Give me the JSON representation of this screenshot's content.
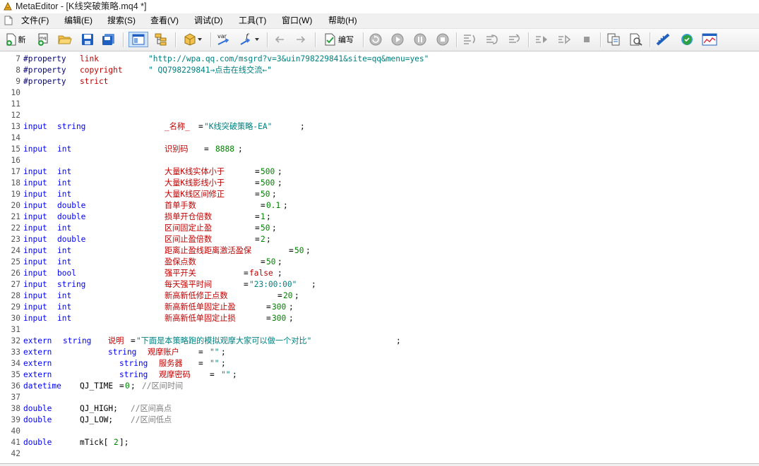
{
  "window": {
    "title": "MetaEditor - [K线突破策略.mq4 *]"
  },
  "menu": [
    {
      "label": "文件(F)"
    },
    {
      "label": "编辑(E)"
    },
    {
      "label": "搜索(S)"
    },
    {
      "label": "查看(V)"
    },
    {
      "label": "调试(D)"
    },
    {
      "label": "工具(T)"
    },
    {
      "label": "窗口(W)"
    },
    {
      "label": "帮助(H)"
    }
  ],
  "toolbar": {
    "new_label": "新",
    "compile_label": "编写",
    "var_label": "var",
    "func_label": "f"
  },
  "code_lines": [
    {
      "n": "7",
      "segs": [
        {
          "t": "#property",
          "c": "dir"
        },
        {
          "t": "link",
          "c": "id"
        },
        {
          "t": "\"http://wpa.qq.com/msgrd?v=3&uin798229841&site=qq&menu=yes\"",
          "c": "str"
        }
      ]
    },
    {
      "n": "8",
      "segs": [
        {
          "t": "#property",
          "c": "dir"
        },
        {
          "t": "copyright",
          "c": "id"
        },
        {
          "t": "\" QQ798229841→点击在线交流←\"",
          "c": "str"
        }
      ]
    },
    {
      "n": "9",
      "segs": [
        {
          "t": "#property",
          "c": "dir"
        },
        {
          "t": "strict",
          "c": "id"
        }
      ]
    },
    {
      "n": "10",
      "segs": []
    },
    {
      "n": "11",
      "segs": []
    },
    {
      "n": "12",
      "segs": []
    },
    {
      "n": "13",
      "segs": [
        {
          "t": "input",
          "c": "kw"
        },
        {
          "t": "string",
          "c": "kw"
        },
        {
          "t": "_名称_",
          "c": "id"
        },
        {
          "t": "=",
          "c": "op"
        },
        {
          "t": "\"K线突破策略-EA\"",
          "c": "str"
        },
        {
          "t": ";",
          "c": "op"
        }
      ]
    },
    {
      "n": "14",
      "segs": []
    },
    {
      "n": "15",
      "segs": [
        {
          "t": "input",
          "c": "kw"
        },
        {
          "t": "int",
          "c": "kw"
        },
        {
          "t": "识别码",
          "c": "id"
        },
        {
          "t": "=",
          "c": "op"
        },
        {
          "t": "8888",
          "c": "num"
        },
        {
          "t": ";",
          "c": "op"
        }
      ]
    },
    {
      "n": "16",
      "segs": []
    },
    {
      "n": "17",
      "segs": [
        {
          "t": "input",
          "c": "kw"
        },
        {
          "t": "int",
          "c": "kw"
        },
        {
          "t": "大量K线实体小于",
          "c": "id"
        },
        {
          "t": "=",
          "c": "op"
        },
        {
          "t": "500",
          "c": "num"
        },
        {
          "t": ";",
          "c": "op"
        }
      ]
    },
    {
      "n": "18",
      "segs": [
        {
          "t": "input",
          "c": "kw"
        },
        {
          "t": "int",
          "c": "kw"
        },
        {
          "t": "大量K线影线小于",
          "c": "id"
        },
        {
          "t": "=",
          "c": "op"
        },
        {
          "t": "500",
          "c": "num"
        },
        {
          "t": ";",
          "c": "op"
        }
      ]
    },
    {
      "n": "19",
      "segs": [
        {
          "t": "input",
          "c": "kw"
        },
        {
          "t": "int",
          "c": "kw"
        },
        {
          "t": "大量K线区间修正",
          "c": "id"
        },
        {
          "t": "=",
          "c": "op"
        },
        {
          "t": "50",
          "c": "num"
        },
        {
          "t": ";",
          "c": "op"
        }
      ]
    },
    {
      "n": "20",
      "segs": [
        {
          "t": "input",
          "c": "kw"
        },
        {
          "t": "double",
          "c": "kw"
        },
        {
          "t": "首单手数",
          "c": "id"
        },
        {
          "t": "=",
          "c": "op"
        },
        {
          "t": "0.1",
          "c": "num"
        },
        {
          "t": ";",
          "c": "op"
        }
      ]
    },
    {
      "n": "21",
      "segs": [
        {
          "t": "input",
          "c": "kw"
        },
        {
          "t": "double",
          "c": "kw"
        },
        {
          "t": "损单开仓倍数",
          "c": "id"
        },
        {
          "t": "=",
          "c": "op"
        },
        {
          "t": "1",
          "c": "num"
        },
        {
          "t": ";",
          "c": "op"
        }
      ]
    },
    {
      "n": "22",
      "segs": [
        {
          "t": "input",
          "c": "kw"
        },
        {
          "t": "int",
          "c": "kw"
        },
        {
          "t": "区间固定止盈",
          "c": "id"
        },
        {
          "t": "=",
          "c": "op"
        },
        {
          "t": "50",
          "c": "num"
        },
        {
          "t": ";",
          "c": "op"
        }
      ]
    },
    {
      "n": "23",
      "segs": [
        {
          "t": "input",
          "c": "kw"
        },
        {
          "t": "double",
          "c": "kw"
        },
        {
          "t": "区间止盈倍数",
          "c": "id"
        },
        {
          "t": "=",
          "c": "op"
        },
        {
          "t": "2",
          "c": "num"
        },
        {
          "t": ";",
          "c": "op"
        }
      ]
    },
    {
      "n": "24",
      "segs": [
        {
          "t": "input",
          "c": "kw"
        },
        {
          "t": "int",
          "c": "kw"
        },
        {
          "t": "距离止盈线距离激活盈保",
          "c": "id"
        },
        {
          "t": "=",
          "c": "op"
        },
        {
          "t": "50",
          "c": "num"
        },
        {
          "t": ";",
          "c": "op"
        }
      ]
    },
    {
      "n": "25",
      "segs": [
        {
          "t": "input",
          "c": "kw"
        },
        {
          "t": "int",
          "c": "kw"
        },
        {
          "t": "盈保点数",
          "c": "id"
        },
        {
          "t": "=",
          "c": "op"
        },
        {
          "t": "50",
          "c": "num"
        },
        {
          "t": ";",
          "c": "op"
        }
      ]
    },
    {
      "n": "26",
      "segs": [
        {
          "t": "input",
          "c": "kw"
        },
        {
          "t": "bool",
          "c": "kw"
        },
        {
          "t": "强平开关",
          "c": "id"
        },
        {
          "t": "=",
          "c": "op"
        },
        {
          "t": "false",
          "c": "id"
        },
        {
          "t": ";",
          "c": "op"
        }
      ]
    },
    {
      "n": "27",
      "segs": [
        {
          "t": "input",
          "c": "kw"
        },
        {
          "t": "string",
          "c": "kw"
        },
        {
          "t": "每天强平时间",
          "c": "id"
        },
        {
          "t": "=",
          "c": "op"
        },
        {
          "t": "\"23:00:00\"",
          "c": "str"
        },
        {
          "t": ";",
          "c": "op"
        }
      ]
    },
    {
      "n": "28",
      "segs": [
        {
          "t": "input",
          "c": "kw"
        },
        {
          "t": "int",
          "c": "kw"
        },
        {
          "t": "新高新低修正点数",
          "c": "id"
        },
        {
          "t": "=",
          "c": "op"
        },
        {
          "t": "20",
          "c": "num"
        },
        {
          "t": ";",
          "c": "op"
        }
      ]
    },
    {
      "n": "29",
      "segs": [
        {
          "t": "input",
          "c": "kw"
        },
        {
          "t": "int",
          "c": "kw"
        },
        {
          "t": "新高新低单固定止盈",
          "c": "id"
        },
        {
          "t": "=",
          "c": "op"
        },
        {
          "t": "300",
          "c": "num"
        },
        {
          "t": ";",
          "c": "op"
        }
      ]
    },
    {
      "n": "30",
      "segs": [
        {
          "t": "input",
          "c": "kw"
        },
        {
          "t": "int",
          "c": "kw"
        },
        {
          "t": "新高新低单固定止损",
          "c": "id"
        },
        {
          "t": "=",
          "c": "op"
        },
        {
          "t": "300",
          "c": "num"
        },
        {
          "t": ";",
          "c": "op"
        }
      ]
    },
    {
      "n": "31",
      "segs": []
    },
    {
      "n": "32",
      "segs": [
        {
          "t": "extern",
          "c": "kw"
        },
        {
          "t": "string",
          "c": "kw"
        },
        {
          "t": "说明",
          "c": "id"
        },
        {
          "t": "=",
          "c": "op"
        },
        {
          "t": "\"下面是本策略跑的模拟观摩大家可以做一个对比\"",
          "c": "str"
        },
        {
          "t": ";",
          "c": "op"
        }
      ]
    },
    {
      "n": "33",
      "segs": [
        {
          "t": "extern",
          "c": "kw"
        },
        {
          "t": "string",
          "c": "kw"
        },
        {
          "t": "观摩账户",
          "c": "id"
        },
        {
          "t": "=",
          "c": "op"
        },
        {
          "t": "\"\"",
          "c": "str"
        },
        {
          "t": ";",
          "c": "op"
        }
      ]
    },
    {
      "n": "34",
      "segs": [
        {
          "t": "extern",
          "c": "kw"
        },
        {
          "t": "string",
          "c": "kw"
        },
        {
          "t": "服务器",
          "c": "id"
        },
        {
          "t": "=",
          "c": "op"
        },
        {
          "t": "\"\"",
          "c": "str"
        },
        {
          "t": ";",
          "c": "op"
        }
      ]
    },
    {
      "n": "35",
      "segs": [
        {
          "t": "extern",
          "c": "kw"
        },
        {
          "t": "string",
          "c": "kw"
        },
        {
          "t": "观摩密码",
          "c": "id"
        },
        {
          "t": "=",
          "c": "op"
        },
        {
          "t": "\"\"",
          "c": "str"
        },
        {
          "t": ";",
          "c": "op"
        }
      ]
    },
    {
      "n": "36",
      "segs": [
        {
          "t": "datetime",
          "c": "kw"
        },
        {
          "t": "QJ_TIME",
          "c": "op"
        },
        {
          "t": "=",
          "c": "op"
        },
        {
          "t": "0",
          "c": "num"
        },
        {
          "t": ";",
          "c": "op"
        },
        {
          "t": "//区间时间",
          "c": "cmt"
        }
      ]
    },
    {
      "n": "37",
      "segs": []
    },
    {
      "n": "38",
      "segs": [
        {
          "t": "double",
          "c": "kw"
        },
        {
          "t": "QJ_HIGH;",
          "c": "op"
        },
        {
          "t": "//区间高点",
          "c": "cmt"
        }
      ]
    },
    {
      "n": "39",
      "segs": [
        {
          "t": "double",
          "c": "kw"
        },
        {
          "t": "QJ_LOW;",
          "c": "op"
        },
        {
          "t": "//区间低点",
          "c": "cmt"
        }
      ]
    },
    {
      "n": "40",
      "segs": []
    },
    {
      "n": "41",
      "segs": [
        {
          "t": "double",
          "c": "kw"
        },
        {
          "t": "mTick[",
          "c": "op"
        },
        {
          "t": "2",
          "c": "num"
        },
        {
          "t": "];",
          "c": "op"
        }
      ]
    },
    {
      "n": "42",
      "segs": []
    }
  ]
}
